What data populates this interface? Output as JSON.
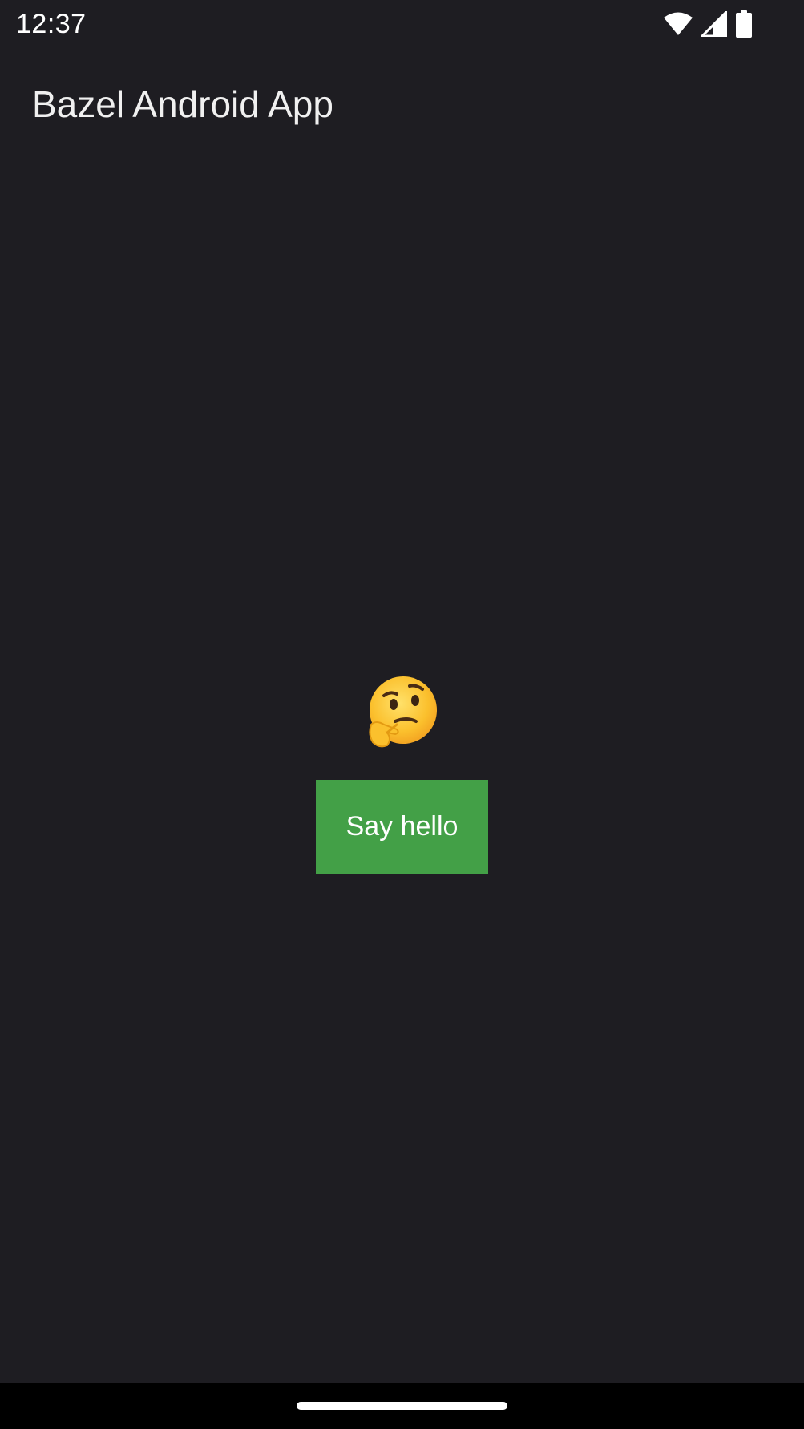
{
  "status_bar": {
    "time": "12:37",
    "icons": [
      "wifi-icon",
      "cellular-signal-icon",
      "battery-icon"
    ]
  },
  "app_bar": {
    "title": "Bazel Android App"
  },
  "main": {
    "emoji": "thinking-face",
    "button_label": "Say hello"
  },
  "colors": {
    "background": "#1e1d22",
    "button": "#43a047",
    "nav_bar": "#000000"
  }
}
